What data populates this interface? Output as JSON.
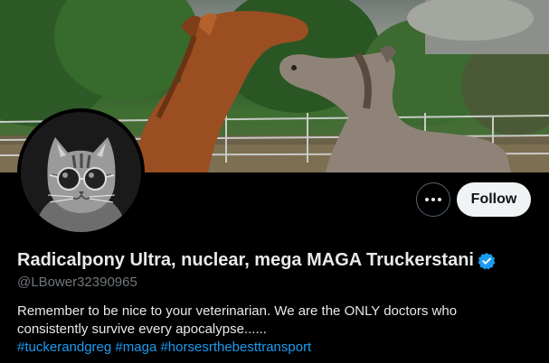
{
  "profile": {
    "display_name": "Radicalpony Ultra, nuclear, mega MAGA Truckerstani",
    "handle": "@LBower32390965",
    "verified": true,
    "bio_lines": [
      "Remember to be nice to your veterinarian.  We are the ONLY doctors who",
      "consistently survive every apocalypse......"
    ],
    "hashtags": [
      "#tuckerandgreg",
      "#maga",
      "#horsesrthebesttransport"
    ]
  },
  "actions": {
    "follow_label": "Follow",
    "more_icon": "more-horizontal-icon"
  },
  "banner": {
    "subject": "two horses playing in a paddock"
  },
  "avatar": {
    "subject": "cat wearing round sunglasses"
  },
  "colors": {
    "background": "#000000",
    "text_primary": "#e7e9ea",
    "text_secondary": "#71767b",
    "link": "#1d9bf0",
    "verified": "#1d9bf0",
    "follow_button_bg": "#eff3f4"
  }
}
